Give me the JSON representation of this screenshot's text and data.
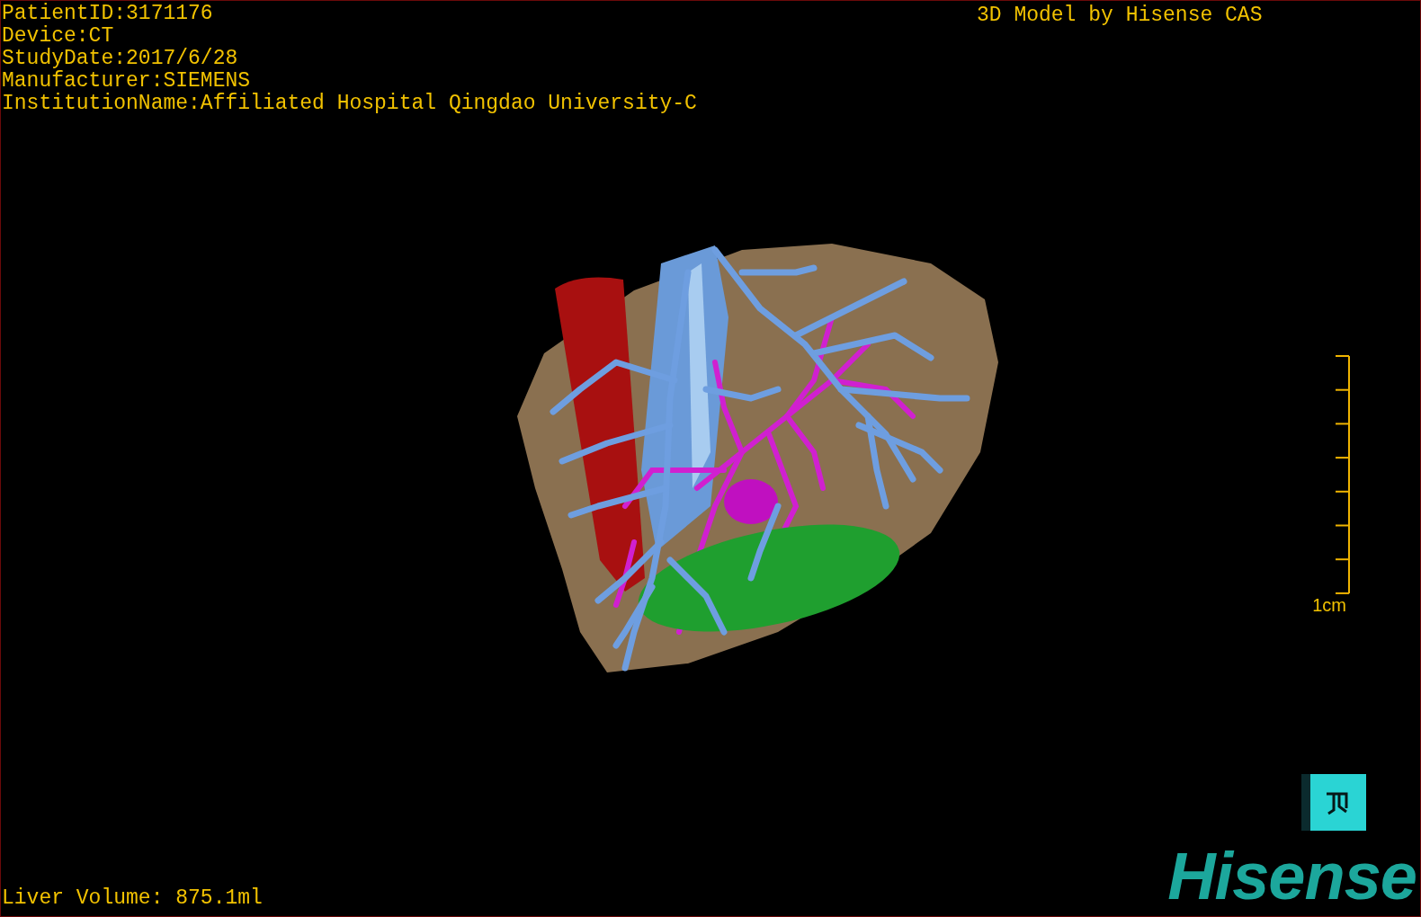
{
  "info_lines": [
    "PatientID:3171176",
    "Device:CT",
    "StudyDate:2017/6/28",
    "Manufacturer:SIEMENS",
    "InstitutionName:Affiliated Hospital Qingdao University-C"
  ],
  "title": "3D Model by Hisense CAS",
  "scale_bar": {
    "label": "1cm"
  },
  "liver_volume": "Liver Volume: 875.1ml",
  "logo": "Hisense"
}
